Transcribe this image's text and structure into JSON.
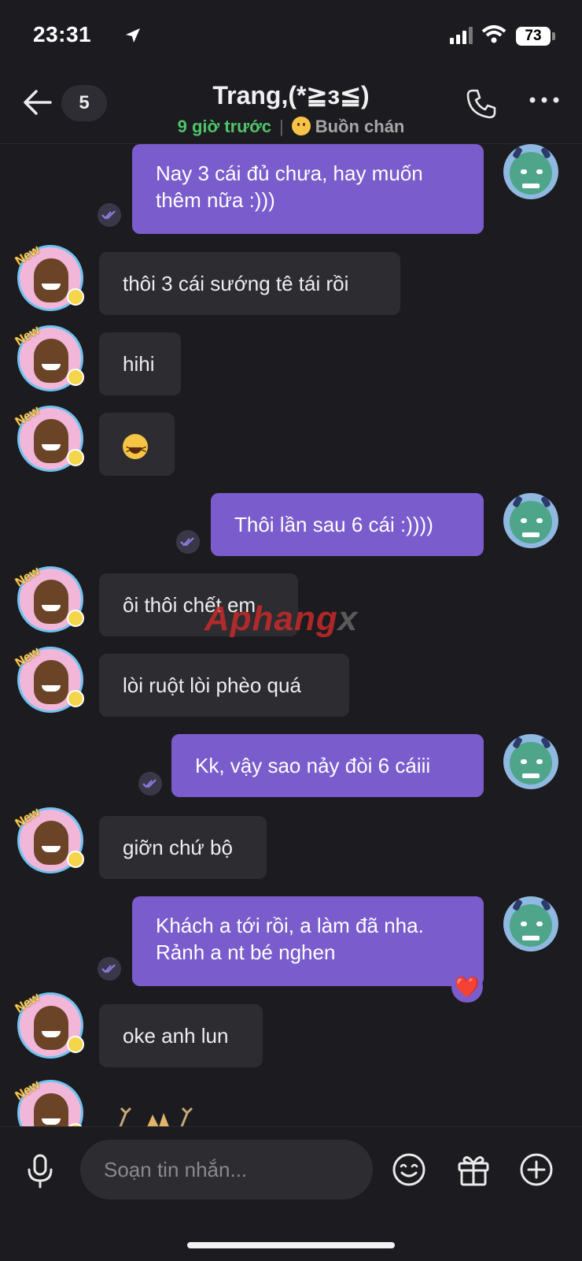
{
  "status_bar": {
    "time": "23:31",
    "battery": "73"
  },
  "header": {
    "unread_count": "5",
    "title": "Trang,(*≧з≦)",
    "last_seen": "9 giờ trước",
    "mood": "Buồn chán"
  },
  "messages": [
    {
      "side": "out",
      "lines": [
        "Nay 3 cái đủ chưa, hay muốn",
        "thêm nữa :)))"
      ]
    },
    {
      "side": "in",
      "text": "thôi 3 cái sướng tê tái rồi"
    },
    {
      "side": "in",
      "text": "hihi"
    },
    {
      "side": "in",
      "emoji": "laughing-emoji"
    },
    {
      "side": "out",
      "text": "Thôi lần sau 6 cái :))))"
    },
    {
      "side": "in",
      "text": "ôi thôi chết em"
    },
    {
      "side": "in",
      "text": "lòi ruột lòi phèo quá"
    },
    {
      "side": "out",
      "text": "Kk, vậy sao nảy đòi 6 cáiii"
    },
    {
      "side": "in",
      "text": "giỡn chứ bộ"
    },
    {
      "side": "out",
      "lines": [
        "Khách a tới rồi, a làm đã nha.",
        "Rảnh a nt bé nghen"
      ],
      "reaction": "❤️"
    },
    {
      "side": "in",
      "text": "oke anh lun"
    }
  ],
  "avatar_badge": "New",
  "watermark": {
    "main": "Aphang",
    "tail": "x"
  },
  "composer": {
    "placeholder": "Soạn tin nhắn..."
  },
  "icons": [
    "back-arrow-icon",
    "phone-icon",
    "more-icon",
    "double-check-icon",
    "mic-icon",
    "emoji-icon",
    "gift-icon",
    "plus-icon"
  ],
  "colors": {
    "outgoing": "#7a5ccd",
    "incoming": "#2d2c31",
    "online": "#4fc36a",
    "background": "#1c1b1f"
  }
}
